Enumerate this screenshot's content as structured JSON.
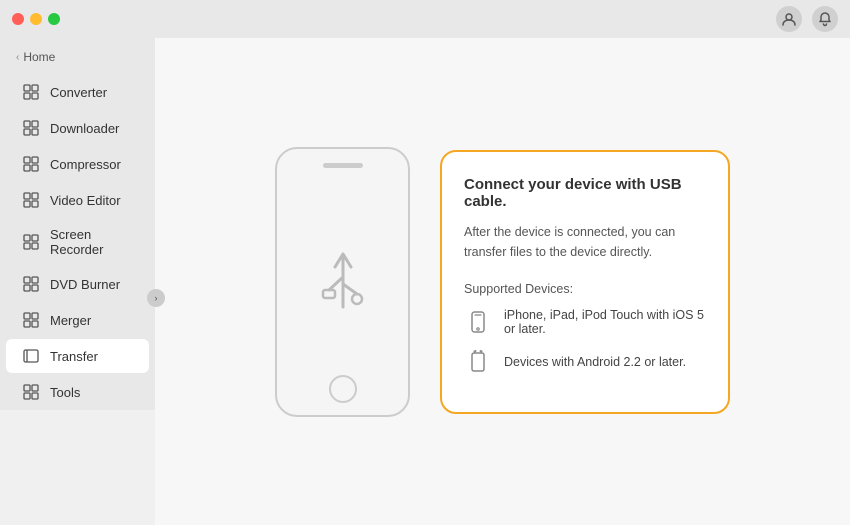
{
  "titlebar": {
    "traffic_lights": [
      "close",
      "minimize",
      "maximize"
    ],
    "icon1": "👤",
    "icon2": "🔔"
  },
  "sidebar": {
    "home_label": "Home",
    "items": [
      {
        "id": "converter",
        "label": "Converter",
        "icon": "⊞"
      },
      {
        "id": "downloader",
        "label": "Downloader",
        "icon": "⊞"
      },
      {
        "id": "compressor",
        "label": "Compressor",
        "icon": "⊞"
      },
      {
        "id": "video-editor",
        "label": "Video Editor",
        "icon": "⊞"
      },
      {
        "id": "screen-recorder",
        "label": "Screen Recorder",
        "icon": "⊞"
      },
      {
        "id": "dvd-burner",
        "label": "DVD Burner",
        "icon": "⊞"
      },
      {
        "id": "merger",
        "label": "Merger",
        "icon": "⊞"
      },
      {
        "id": "transfer",
        "label": "Transfer",
        "icon": "⊟",
        "active": true
      },
      {
        "id": "tools",
        "label": "Tools",
        "icon": "⊞"
      }
    ]
  },
  "main": {
    "info_panel": {
      "title": "Connect your device with USB cable.",
      "description": "After the device is connected, you can transfer files to the device directly.",
      "supported_label": "Supported Devices:",
      "devices": [
        {
          "id": "apple",
          "text": "iPhone, iPad, iPod Touch with iOS 5 or later."
        },
        {
          "id": "android",
          "text": "Devices with Android 2.2 or later."
        }
      ]
    }
  }
}
